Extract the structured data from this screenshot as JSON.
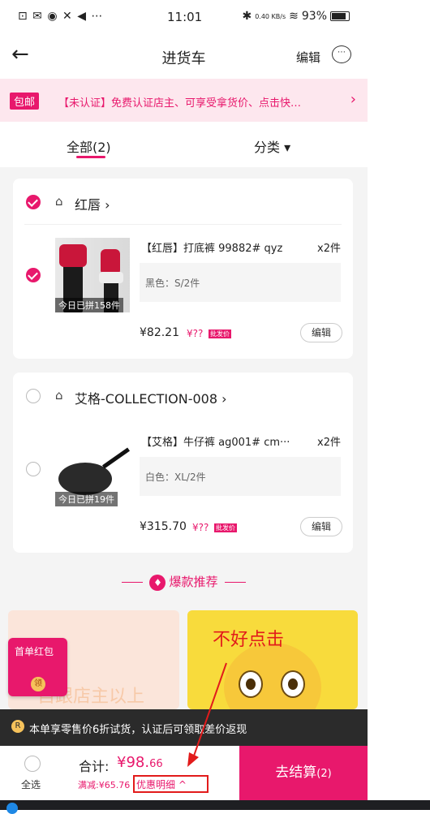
{
  "status_bar": {
    "icons_left": "⊡ ✉ ◉ ✕ ◀ ⋯",
    "time": "11:01",
    "speed": "0.40 KB/s",
    "battery": "93%"
  },
  "nav": {
    "back_icon": "←",
    "title": "进货车",
    "edit": "编辑",
    "chat_icon": "⋯"
  },
  "banner": {
    "badge": "包邮",
    "text": "【未认证】免费认证店主、可享受拿货价、点击快…",
    "arrow": "›"
  },
  "tabs": {
    "all": "全部(2)",
    "category": "分类 ▾"
  },
  "shops": [
    {
      "name": "红唇 ›",
      "checked": true,
      "product": {
        "image_label": "今日已拼158件",
        "title": "【红唇】打底裤 99882# qyz",
        "qty": "x2件",
        "spec": "黑色：S/2件",
        "price": "¥82.21",
        "price2": "¥??",
        "badge": "批发价",
        "edit": "编辑"
      }
    },
    {
      "name": "艾格-COLLECTION-008 ›",
      "checked": false,
      "product": {
        "image_label": "今日已拼19件",
        "title": "【艾格】牛仔裤 ag001# cm···",
        "qty": "x2件",
        "spec": "白色：XL/2件",
        "price": "¥315.70",
        "price2": "¥??",
        "badge": "批发价",
        "edit": "编辑"
      }
    }
  ],
  "recommend": {
    "title": "爆款推荐",
    "card1_text": "自跟店主以上"
  },
  "red_packet": {
    "title": "首单红包",
    "coin": "领"
  },
  "annotation": {
    "text": "不好点击"
  },
  "notice": {
    "icon": "R",
    "text": "本单享零售价6折试货，认证后可领取差价返现"
  },
  "bottom": {
    "select_all": "全选",
    "total_label": "合计:",
    "total_main": "¥98.",
    "total_cents": "66",
    "discount": "满减:¥65.76",
    "detail": "优惠明细 ^",
    "checkout": "去结算",
    "checkout_count": "(2)"
  },
  "colors": {
    "accent": "#e8186c",
    "annotation": "#e21b1b"
  }
}
